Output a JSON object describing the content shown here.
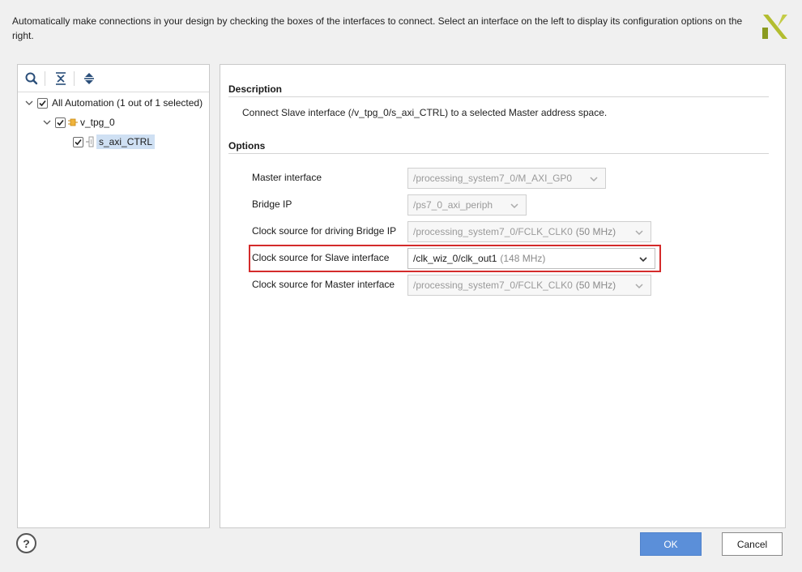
{
  "header": {
    "text": "Automatically make connections in your design by checking the boxes of the interfaces to connect. Select an interface on the left to display its configuration options on the right."
  },
  "tree": {
    "root_label": "All Automation (1 out of 1 selected)",
    "child_label": "v_tpg_0",
    "leaf_label": "s_axi_CTRL"
  },
  "description": {
    "title": "Description",
    "text": "Connect Slave interface (/v_tpg_0/s_axi_CTRL) to a selected Master address space."
  },
  "options": {
    "title": "Options",
    "rows": [
      {
        "label": "Master interface",
        "value": "/processing_system7_0/M_AXI_GP0",
        "freq": ""
      },
      {
        "label": "Bridge IP",
        "value": "/ps7_0_axi_periph",
        "freq": ""
      },
      {
        "label": "Clock source for driving Bridge IP",
        "value": "/processing_system7_0/FCLK_CLK0",
        "freq": "(50 MHz)"
      },
      {
        "label": "Clock source for Slave interface",
        "value": "/clk_wiz_0/clk_out1",
        "freq": "(148 MHz)"
      },
      {
        "label": "Clock source for Master interface",
        "value": "/processing_system7_0/FCLK_CLK0",
        "freq": "(50 MHz)"
      }
    ]
  },
  "footer": {
    "help": "?",
    "ok": "OK",
    "cancel": "Cancel"
  },
  "colors": {
    "accent": "#5b8fd9",
    "highlight": "#d42b2b",
    "selection": "#cfe0f3"
  }
}
